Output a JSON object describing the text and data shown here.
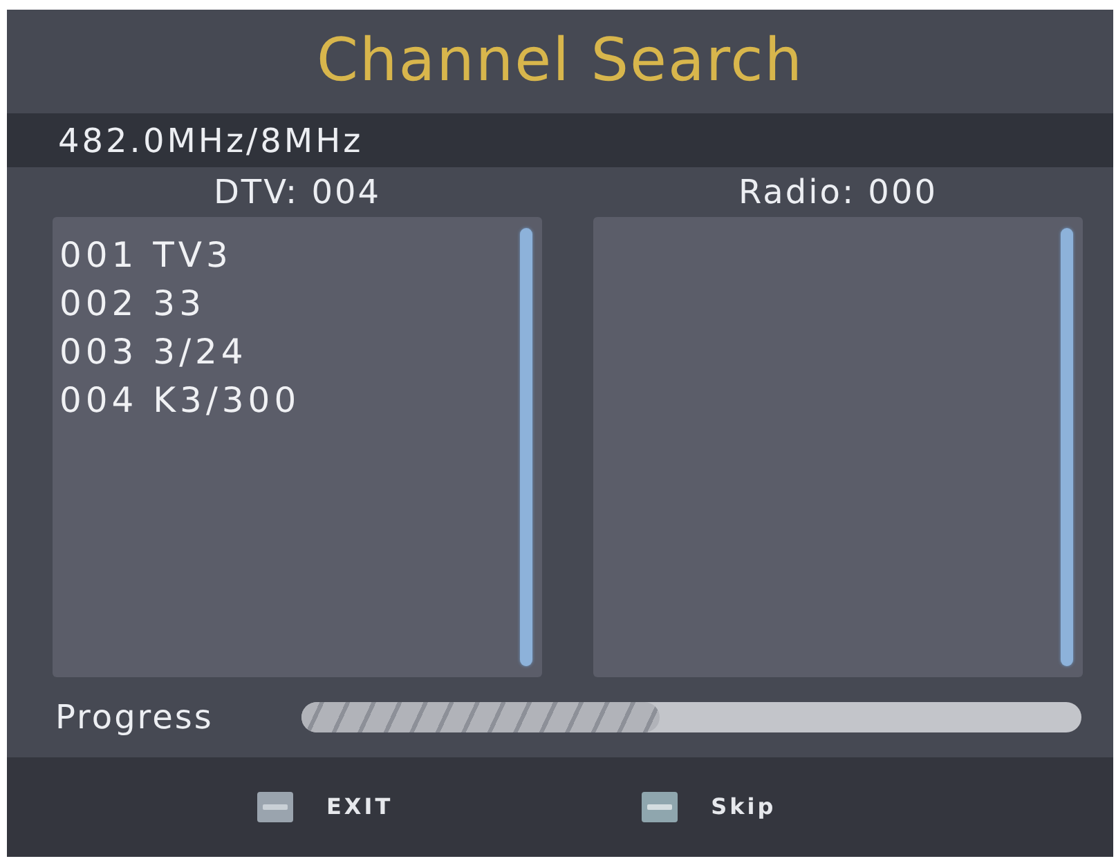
{
  "title": "Channel Search",
  "frequency": "482.0MHz/8MHz",
  "lists": [
    {
      "header": "DTV: 004",
      "channels": [
        "001 TV3",
        "002 33",
        "003 3/24",
        "004 K3/300"
      ]
    },
    {
      "header": "Radio: 000"
    }
  ],
  "progress": {
    "label": "Progress",
    "level": 0.46
  },
  "keys": [
    {
      "kind": "exit",
      "label": "EXIT"
    },
    {
      "kind": "menu",
      "label": "Skip"
    }
  ]
}
